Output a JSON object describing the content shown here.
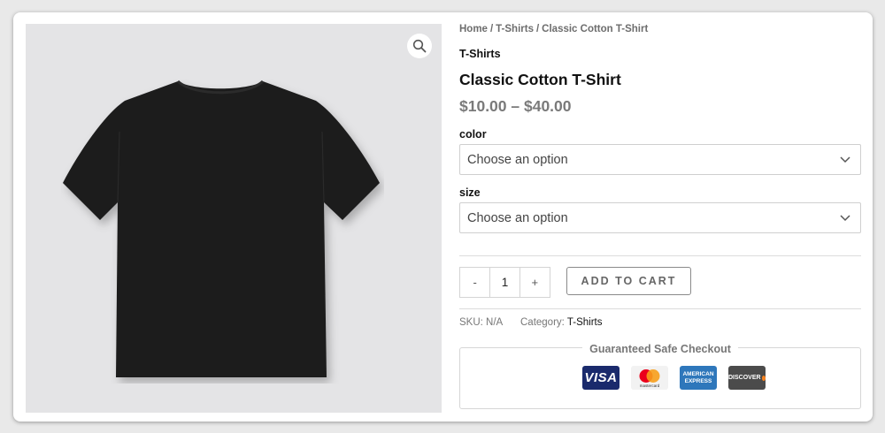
{
  "breadcrumb": {
    "home": "Home",
    "sep": "/",
    "category": "T-Shirts",
    "current": "Classic Cotton T-Shirt"
  },
  "product": {
    "category": "T-Shirts",
    "title": "Classic Cotton T-Shirt",
    "price": "$10.00 – $40.00",
    "image_icon": "tshirt-black"
  },
  "variations": {
    "color": {
      "label": "color",
      "selected": "Choose an option"
    },
    "size": {
      "label": "size",
      "selected": "Choose an option"
    }
  },
  "quantity": {
    "minus": "-",
    "value": "1",
    "plus": "+"
  },
  "add_to_cart": "ADD TO CART",
  "meta": {
    "sku_label": "SKU:",
    "sku_value": "N/A",
    "category_label": "Category:",
    "category_value": "T-Shirts"
  },
  "checkout": {
    "title": "Guaranteed Safe Checkout",
    "cards": [
      {
        "name": "visa",
        "text": "VISA",
        "color": "#1a2a6c"
      },
      {
        "name": "mastercard",
        "text": "mastercard",
        "color": "#f2f2f2"
      },
      {
        "name": "amex",
        "text_top": "AMERICAN",
        "text_bottom": "EXPRESS",
        "color": "#2e77bb"
      },
      {
        "name": "discover",
        "text": "DISCOVER",
        "color": "#4b4b4b"
      }
    ]
  },
  "colors": {
    "price": "#7a7a7a",
    "gallery_bg": "#e4e4e6",
    "shirt": "#1c1c1c"
  },
  "icons": {
    "zoom": "search-icon",
    "dropdown": "chevron-down-icon"
  }
}
